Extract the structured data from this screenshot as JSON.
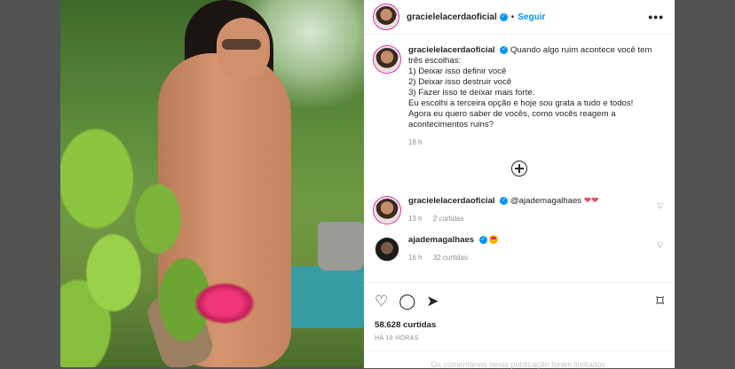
{
  "post": {
    "username": "gracielelacerdaoficial",
    "follow_label": "Seguir",
    "more_label": "•••",
    "caption_lines": [
      "Quando algo ruim acontece você tem três escolhas:",
      "1) Deixar isso definir você",
      "2) Deixar isso destruir você",
      "3) Fazer isso te deixar mais forte.",
      "Eu escolhi a terceira opção e hoje sou grata a tudo e todos!",
      "Agora eu quero saber de vocês, como vocês reagem a acontecimentos ruins?"
    ],
    "caption_time": "18 h"
  },
  "comments": [
    {
      "username": "gracielelacerdaoficial",
      "text": "@ajademagalhaes",
      "hearts": "❤❤",
      "time": "13 h",
      "likes": "2 curtidas"
    },
    {
      "username": "ajademagalhaes",
      "text": "",
      "time": "16 h",
      "likes": "32 curtidas"
    }
  ],
  "footer": {
    "likes": "58.628 curtidas",
    "time": "HÁ 18 HORAS",
    "limited_notice": "Os comentários nesta publicação foram limitados."
  },
  "colors": {
    "accent": "#0095f6",
    "heart": "#ed4956"
  }
}
